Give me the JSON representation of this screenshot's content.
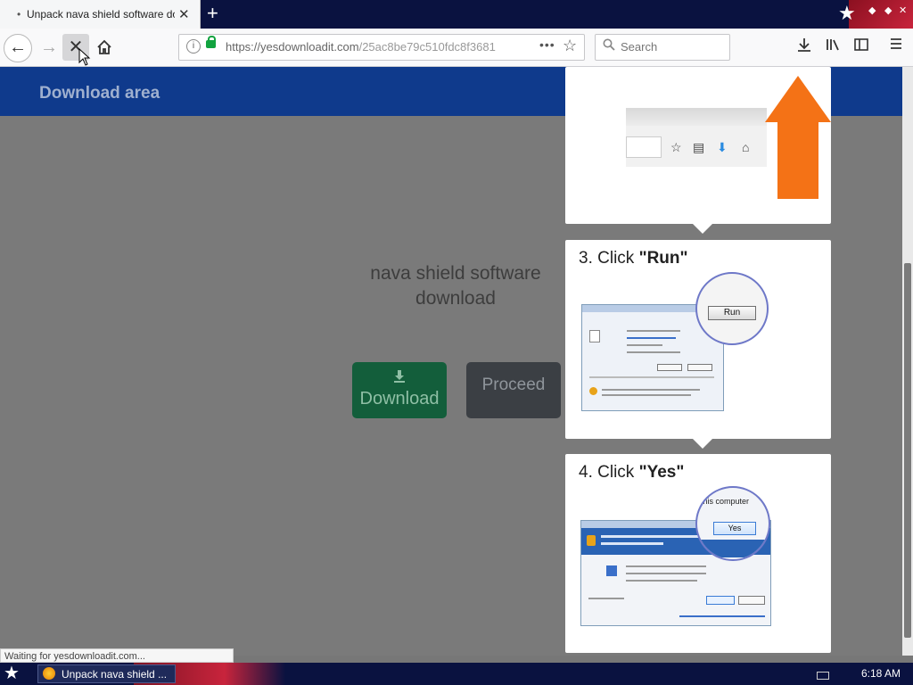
{
  "browser": {
    "tab": {
      "title": "Unpack nava shield software down",
      "indicator": "•"
    },
    "new_tab": "+",
    "url": {
      "domain": "https://yesdownloadit.com",
      "path": "/25ac8be79c510fdc8f3681",
      "page_actions": "•••"
    },
    "search": {
      "placeholder": "Search"
    },
    "status_text": "Waiting for yesdownloadit.com..."
  },
  "page": {
    "header_title": "Download area",
    "heading": "nava shield software download",
    "download_label": "Download",
    "proceed_label": "Proceed"
  },
  "instructions": {
    "step3": {
      "prefix": "3. Click ",
      "action": "\"Run\"",
      "zoom_button": "Run"
    },
    "step4": {
      "prefix": "4. Click ",
      "action": "\"Yes\"",
      "zoom_text": "this computer",
      "zoom_button": "Yes"
    }
  },
  "taskbar": {
    "task_label": "Unpack nava shield ...",
    "clock": "6:18 AM"
  },
  "colors": {
    "header_band": "#0f3a8c",
    "download_button": "#135e3b",
    "proceed_button": "#3b3f44",
    "arrow": "#f47216"
  },
  "icons": [
    "back-arrow-icon",
    "forward-arrow-icon",
    "stop-icon",
    "home-icon",
    "info-icon",
    "lock-icon",
    "bookmark-star-icon",
    "search-icon",
    "downloads-icon",
    "library-icon",
    "sidebar-icon",
    "menu-icon",
    "download-arrow-icon",
    "orange-up-arrow-icon"
  ]
}
